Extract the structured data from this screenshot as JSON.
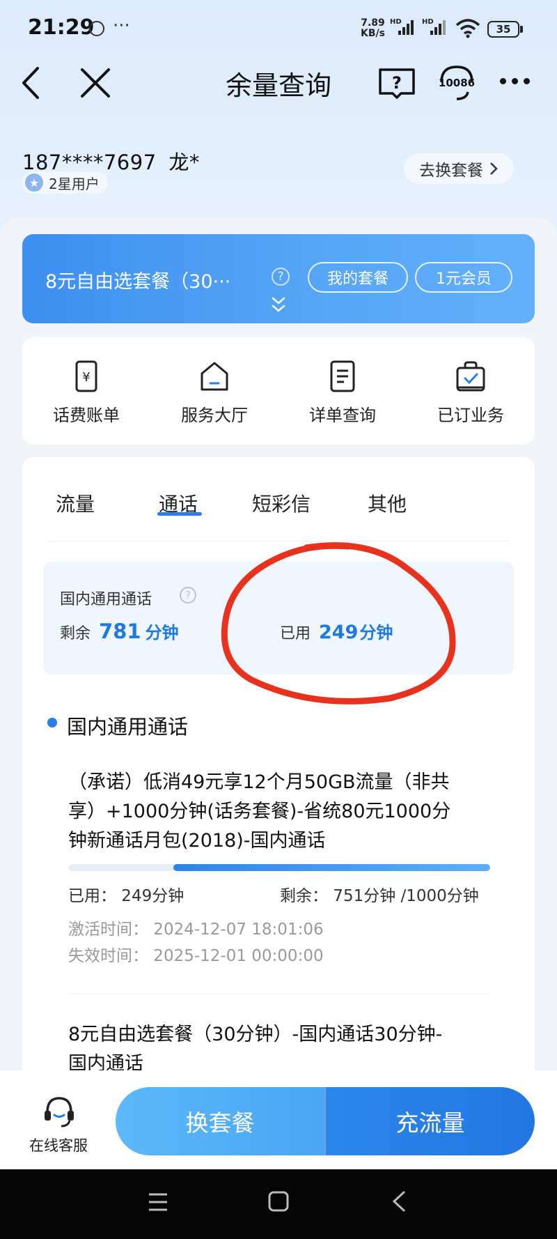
{
  "status_bar": {
    "time": "21:29",
    "more": "···",
    "net_speed_value": "7.89",
    "net_speed_unit": "KB/s",
    "signal_label_1": "HD",
    "signal_label_2": "HD",
    "battery": "35"
  },
  "nav": {
    "title": "余量查询",
    "hotline": "10086"
  },
  "user": {
    "phone": "187****7697",
    "name": "龙*",
    "level": "2星用户",
    "change_plan": "去换套餐"
  },
  "banner": {
    "plan_name": "8元自由选套餐（30···",
    "my_plan_button": "我的套餐",
    "member_button": "1元会员"
  },
  "quick_actions": [
    {
      "label": "话费账单",
      "icon": "bill-icon"
    },
    {
      "label": "服务大厅",
      "icon": "home-icon"
    },
    {
      "label": "详单查询",
      "icon": "list-icon"
    },
    {
      "label": "已订业务",
      "icon": "subscribed-icon"
    }
  ],
  "tabs": [
    {
      "label": "流量",
      "active": false
    },
    {
      "label": "通话",
      "active": true
    },
    {
      "label": "短彩信",
      "active": false
    },
    {
      "label": "其他",
      "active": false
    }
  ],
  "summary": {
    "title": "国内通用通话",
    "remain_label": "剩余",
    "remain_value": "781",
    "remain_unit": "分钟",
    "used_label": "已用",
    "used_value": "249",
    "used_unit": "分钟"
  },
  "section": {
    "title": "国内通用通话"
  },
  "packages": [
    {
      "line1": "（承诺）低消49元享12个月50GB流量（非共",
      "line2": "享）+1000分钟(话务套餐)-省统80元1000分",
      "line3": "钟新通话月包(2018)-国内通话",
      "used": "已用：  249分钟",
      "remain": "剩余：   751分钟 /1000分钟",
      "used_fraction": 0.249,
      "activation": "激活时间：  2024-12-07 18:01:06",
      "expiry": "失效时间：  2025-12-01 00:00:00"
    },
    {
      "line1": "8元自由选套餐（30分钟）-国内通话30分钟-",
      "line2": "国内通话"
    }
  ],
  "bottom": {
    "customer_service": "在线客服",
    "change_plan": "换套餐",
    "top_up_data": "充流量"
  },
  "colors": {
    "accent": "#2b7ce9",
    "annotation": "#e8321e"
  }
}
